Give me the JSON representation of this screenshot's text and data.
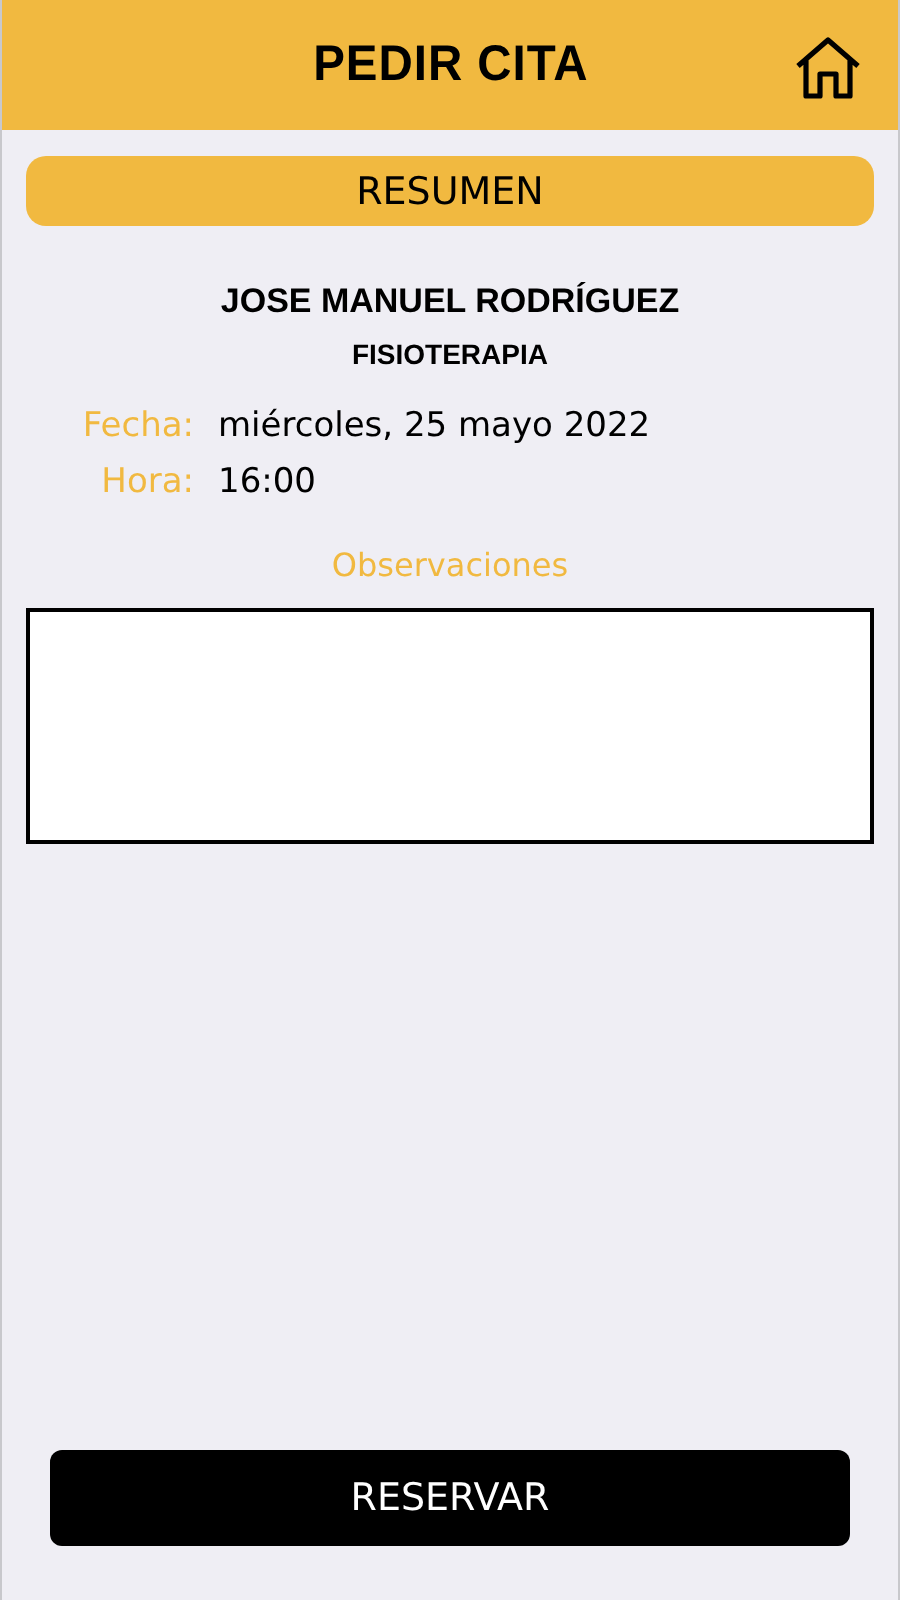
{
  "header": {
    "title": "PEDIR CITA"
  },
  "section_title": "RESUMEN",
  "professional": {
    "name": "JOSE MANUEL RODRÍGUEZ",
    "specialty": "FISIOTERAPIA"
  },
  "details": [
    {
      "label": "Fecha:",
      "value": "miércoles, 25 mayo 2022"
    },
    {
      "label": "Hora:",
      "value": "16:00"
    }
  ],
  "notes": {
    "label": "Observaciones"
  },
  "submit": {
    "label": "RESERVAR"
  }
}
